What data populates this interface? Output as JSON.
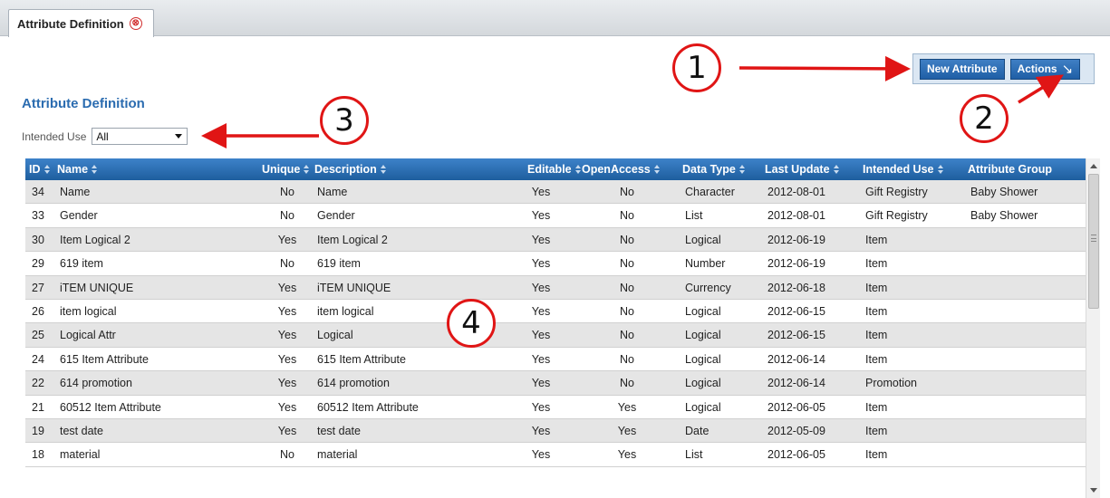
{
  "tab": {
    "label": "Attribute Definition",
    "close_glyph": "⊗"
  },
  "toolbar": {
    "new_label": "New Attribute",
    "actions_label": "Actions",
    "actions_glyph": "↘"
  },
  "page": {
    "title": "Attribute Definition"
  },
  "filter": {
    "label": "Intended Use",
    "value": "All"
  },
  "columns": [
    "ID",
    "Name",
    "Unique",
    "Description",
    "Editable",
    "OpenAccess",
    "Data Type",
    "Last Update",
    "Intended Use",
    "Attribute Group"
  ],
  "rows": [
    [
      "34",
      "Name",
      "No",
      "Name",
      "Yes",
      "No",
      "Character",
      "2012-08-01",
      "Gift Registry",
      "Baby Shower"
    ],
    [
      "33",
      "Gender",
      "No",
      "Gender",
      "Yes",
      "No",
      "List",
      "2012-08-01",
      "Gift Registry",
      "Baby Shower"
    ],
    [
      "30",
      "Item Logical 2",
      "Yes",
      "Item Logical 2",
      "Yes",
      "No",
      "Logical",
      "2012-06-19",
      "Item",
      ""
    ],
    [
      "29",
      "619 item",
      "No",
      "619 item",
      "Yes",
      "No",
      "Number",
      "2012-06-19",
      "Item",
      ""
    ],
    [
      "27",
      "iTEM UNIQUE",
      "Yes",
      "iTEM UNIQUE",
      "Yes",
      "No",
      "Currency",
      "2012-06-18",
      "Item",
      ""
    ],
    [
      "26",
      "item logical",
      "Yes",
      "item logical",
      "Yes",
      "No",
      "Logical",
      "2012-06-15",
      "Item",
      ""
    ],
    [
      "25",
      "Logical Attr",
      "Yes",
      "Logical",
      "Yes",
      "No",
      "Logical",
      "2012-06-15",
      "Item",
      ""
    ],
    [
      "24",
      "615 Item Attribute",
      "Yes",
      "615 Item Attribute",
      "Yes",
      "No",
      "Logical",
      "2012-06-14",
      "Item",
      ""
    ],
    [
      "22",
      "614 promotion",
      "Yes",
      "614 promotion",
      "Yes",
      "No",
      "Logical",
      "2012-06-14",
      "Promotion",
      ""
    ],
    [
      "21",
      "60512 Item Attribute",
      "Yes",
      "60512 Item Attribute",
      "Yes",
      "Yes",
      "Logical",
      "2012-06-05",
      "Item",
      ""
    ],
    [
      "19",
      "test date",
      "Yes",
      "test date",
      "Yes",
      "Yes",
      "Date",
      "2012-05-09",
      "Item",
      ""
    ],
    [
      "18",
      "material",
      "No",
      "material",
      "Yes",
      "Yes",
      "List",
      "2012-06-05",
      "Item",
      ""
    ]
  ],
  "callouts": [
    "1",
    "2",
    "3",
    "4"
  ],
  "colors": {
    "header": "#2a6fb5",
    "accent_red": "#e01515",
    "title_blue": "#2b6cb0"
  }
}
